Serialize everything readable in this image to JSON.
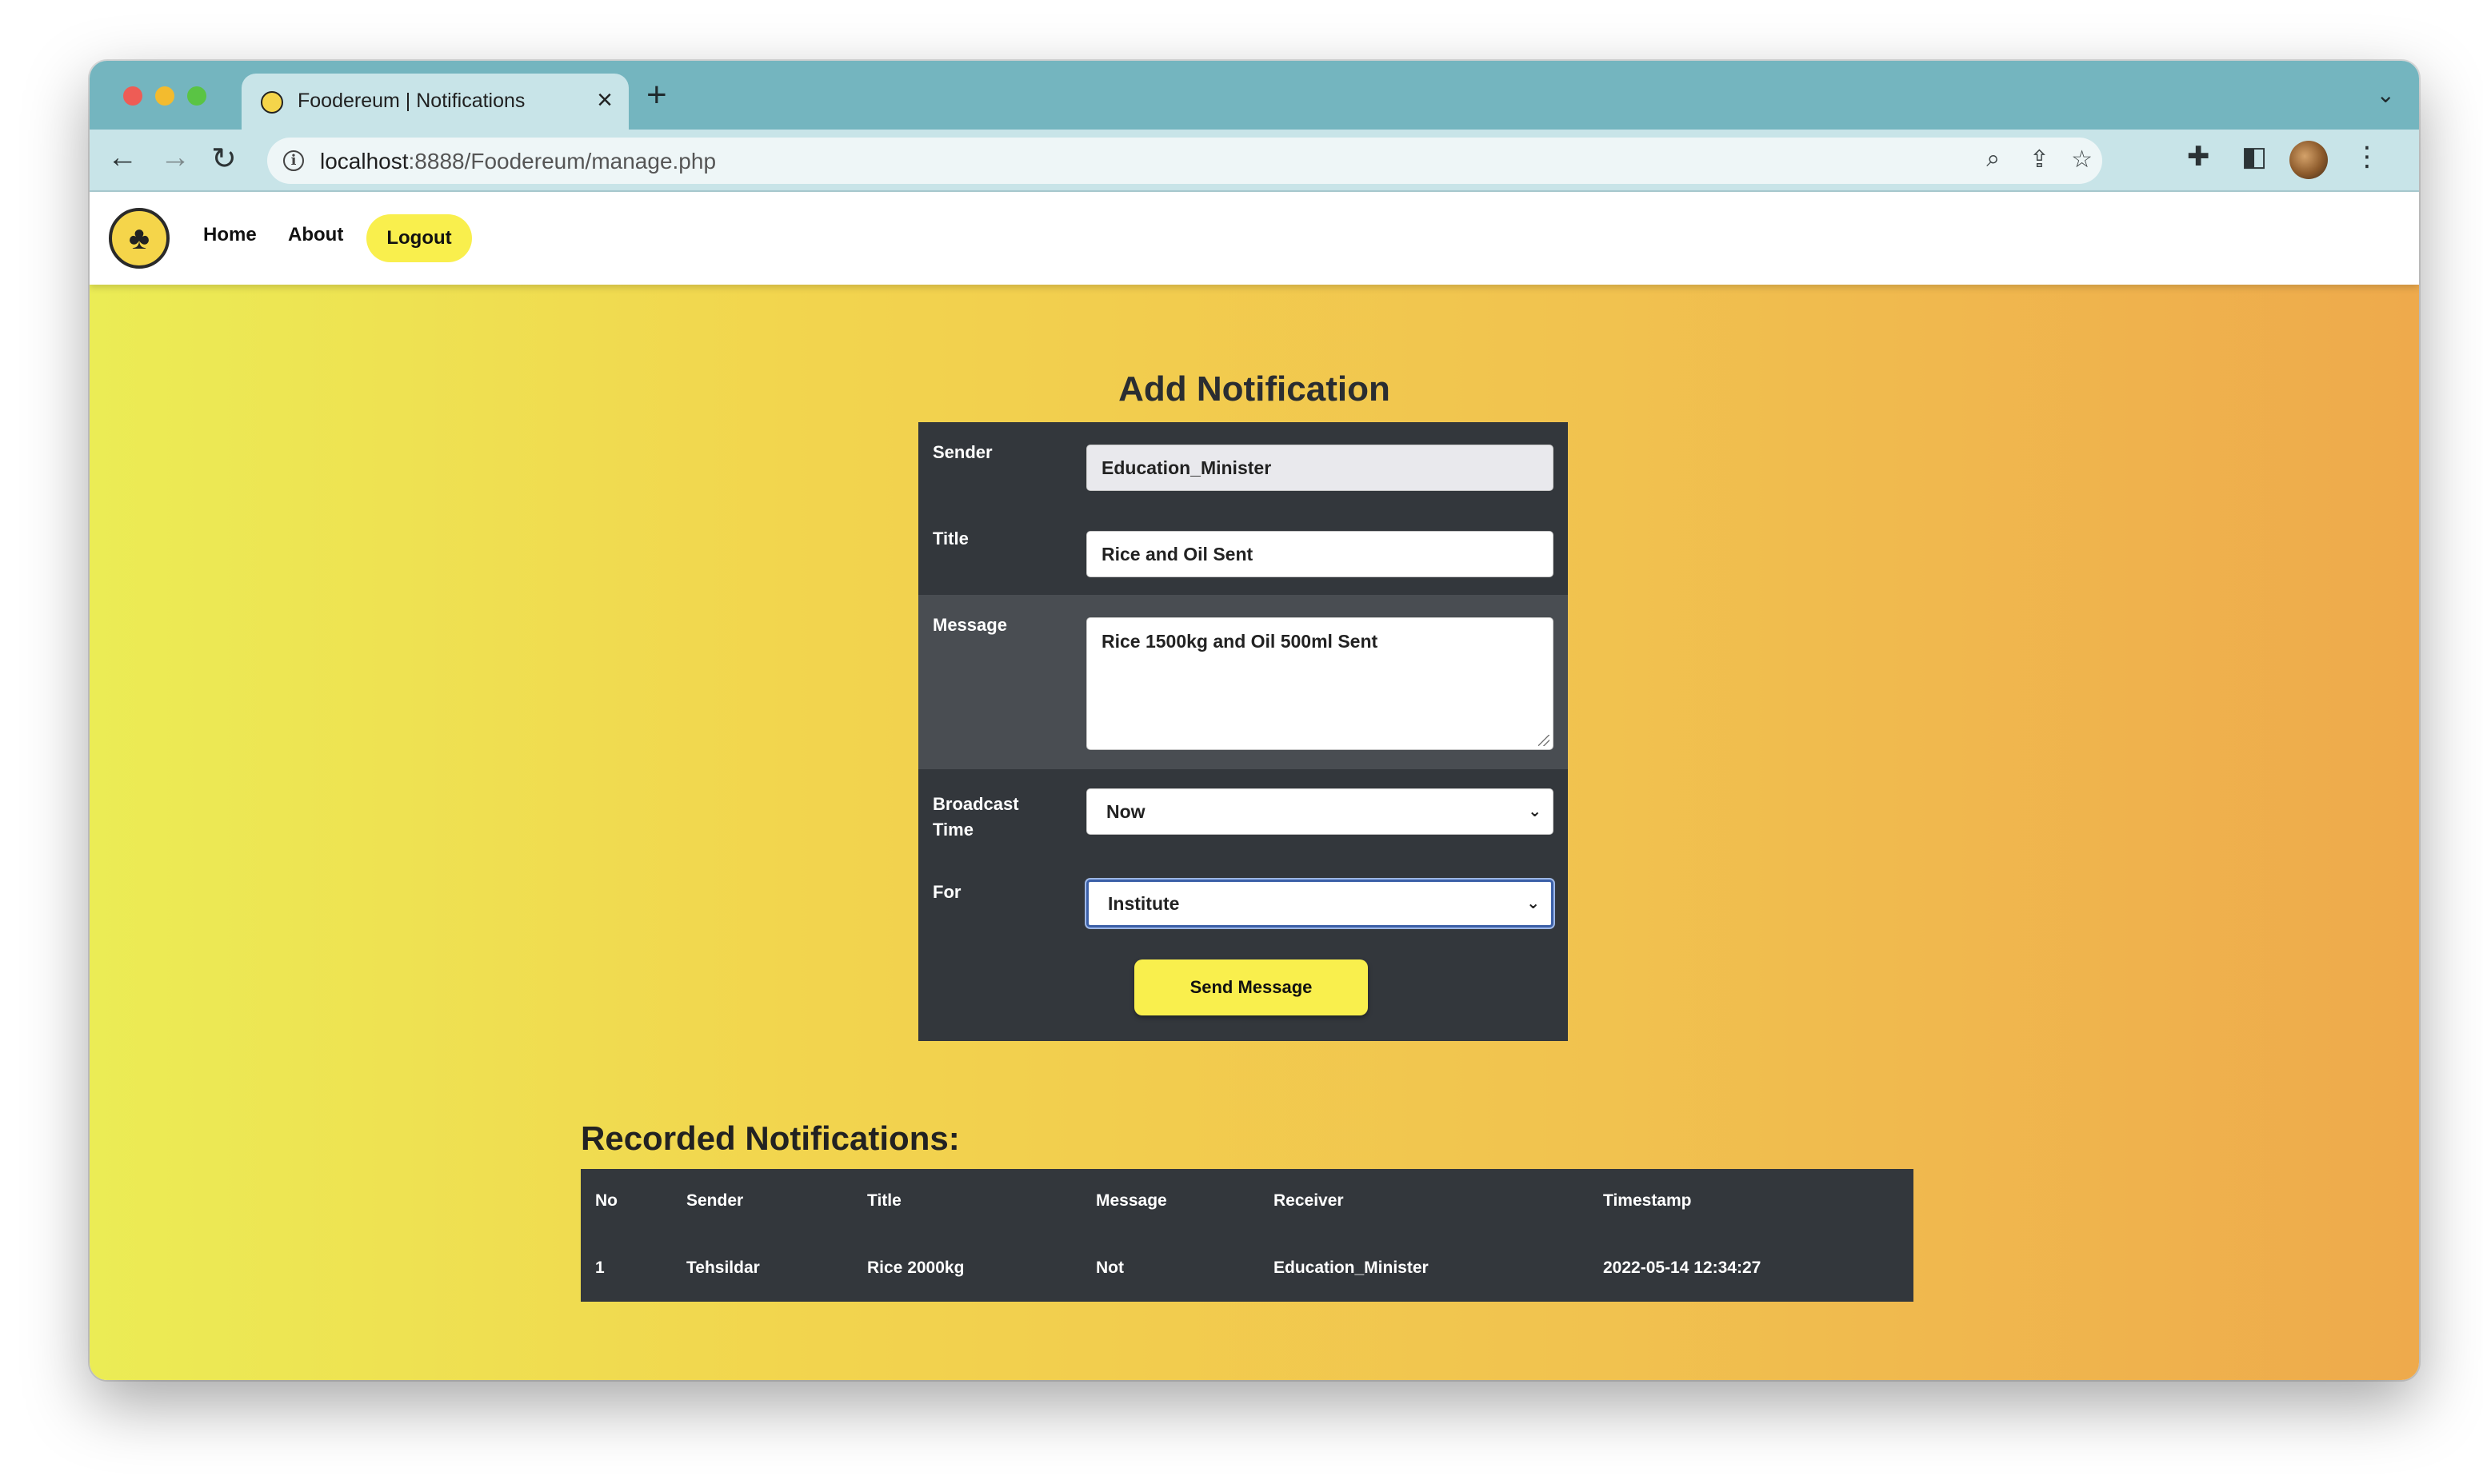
{
  "browser": {
    "tab_title": "Foodereum | Notifications",
    "url_host": "localhost",
    "url_path": ":8888/Foodereum/manage.php"
  },
  "site_nav": {
    "home": "Home",
    "about": "About",
    "logout": "Logout"
  },
  "form": {
    "title": "Add Notification",
    "sender_label": "Sender",
    "sender_value": "Education_Minister",
    "title_label": "Title",
    "title_value": "Rice and Oil Sent",
    "message_label": "Message",
    "message_value": "Rice 1500kg and Oil 500ml Sent",
    "broadcast_label_1": "Broadcast",
    "broadcast_label_2": "Time",
    "broadcast_value": "Now",
    "for_label": "For",
    "for_value": "Institute",
    "send_button": "Send Message"
  },
  "recorded": {
    "title": "Recorded Notifications:",
    "columns": [
      "No",
      "Sender",
      "Title",
      "Message",
      "Receiver",
      "Timestamp"
    ],
    "rows": [
      [
        "1",
        "Tehsildar",
        "Rice 2000kg",
        "Not",
        "Education_Minister",
        "2022-05-14 12:34:27"
      ]
    ]
  }
}
